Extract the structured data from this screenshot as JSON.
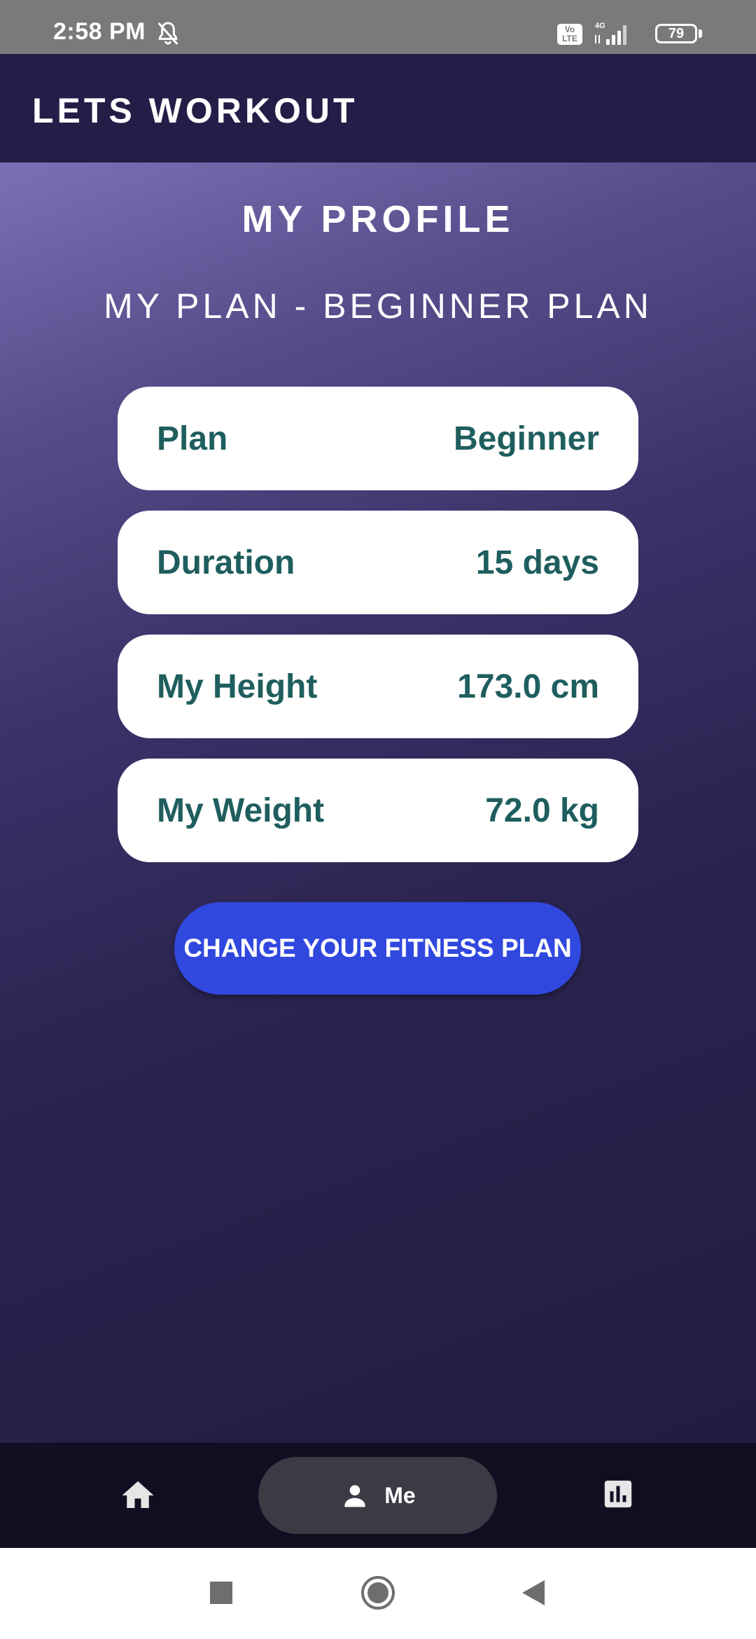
{
  "status_bar": {
    "time": "2:58 PM",
    "volte": "Vo LTE",
    "network": "4G",
    "battery": "79",
    "icons": [
      "bell-off-icon",
      "volte-icon",
      "signal-icon",
      "battery-icon"
    ]
  },
  "app_bar": {
    "title": "LETS WORKOUT"
  },
  "profile": {
    "title": "MY PROFILE",
    "subtitle": "MY PLAN - BEGINNER PLAN",
    "items": [
      {
        "label": "Plan",
        "value": "Beginner"
      },
      {
        "label": "Duration",
        "value": "15 days"
      },
      {
        "label": "My Height",
        "value": "173.0 cm"
      },
      {
        "label": "My Weight",
        "value": "72.0 kg"
      }
    ],
    "change_button": "CHANGE YOUR FITNESS PLAN"
  },
  "bottom_nav": {
    "items": [
      {
        "icon": "home-icon",
        "label": ""
      },
      {
        "icon": "person-icon",
        "label": "Me",
        "selected": true
      },
      {
        "icon": "bar-chart-icon",
        "label": ""
      }
    ]
  },
  "system_nav": {
    "icons": [
      "recents-square-icon",
      "home-circle-icon",
      "back-triangle-icon"
    ]
  },
  "colors": {
    "app_bar": "#241d47",
    "card_text": "#1f5e5e",
    "button": "#3048de",
    "nav_bg": "#120e22",
    "nav_selected": "#3b3a45"
  }
}
